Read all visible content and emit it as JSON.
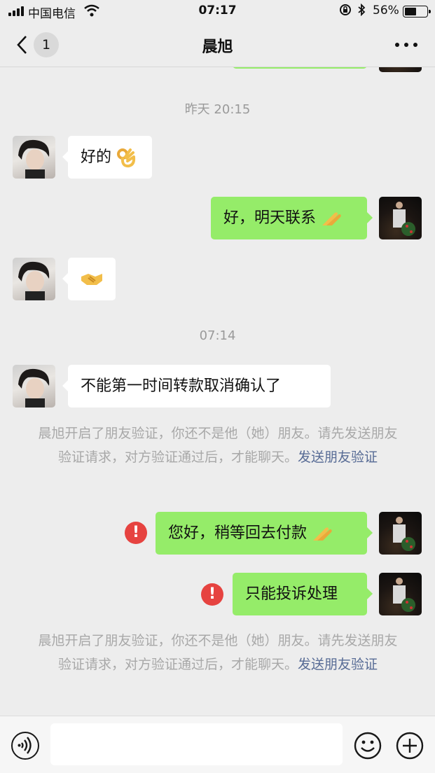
{
  "status_bar": {
    "carrier": "中国电信",
    "time": "07:17",
    "battery_percent": "56%",
    "battery_level": 0.56,
    "icons": [
      "signal-icon",
      "wifi-icon",
      "orientation-lock-icon",
      "bluetooth-icon",
      "battery-icon"
    ]
  },
  "nav": {
    "title": "晨旭",
    "unread_count": "1",
    "icons": [
      "back-arrow-icon",
      "more-dots-icon"
    ]
  },
  "chat": {
    "timestamp_1": "昨天 20:15",
    "msg_1": "好的",
    "msg_1_emoji": "ok-hand-emoji",
    "msg_2": "好，明天联系",
    "msg_2_emoji": "clapping-hands-emoji",
    "msg_3_emoji": "handshake-emoji",
    "timestamp_2": "07:14",
    "msg_4": "不能第一时间转款取消确认了",
    "system_1_text": "晨旭开启了朋友验证，你还不是他（她）朋友。请先发送朋友验证请求，对方验证通过后，才能聊天。",
    "system_1_link": "发送朋友验证",
    "msg_5": "您好，稍等回去付款",
    "msg_5_emoji": "clapping-hands-emoji",
    "msg_5_error": "!",
    "msg_6": "只能投诉处理",
    "msg_6_error": "!",
    "system_2_text": "晨旭开启了朋友验证，你还不是他（她）朋友。请先发送朋友验证请求，对方验证通过后，才能聊天。",
    "system_2_link": "发送朋友验证"
  },
  "input_bar": {
    "placeholder": "",
    "icons": [
      "voice-icon",
      "emoji-icon",
      "plus-icon"
    ]
  },
  "colors": {
    "background": "#EDEDED",
    "bubble_self": "#95EC69",
    "bubble_friend": "#FFFFFF",
    "error_red": "#E64340",
    "link_blue": "#576B95",
    "system_text": "#A8A8A8"
  }
}
